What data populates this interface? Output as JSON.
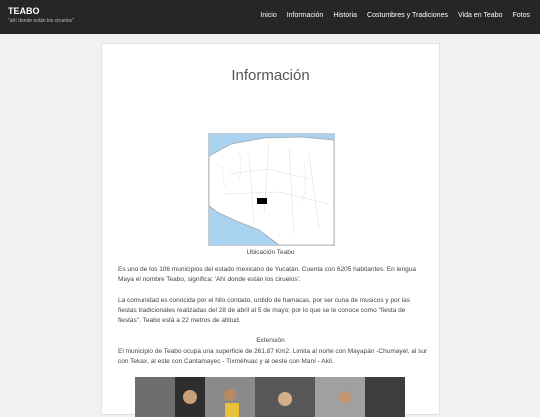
{
  "site": {
    "title": "TEABO",
    "description": "\"ahí donde están los ciruelos\""
  },
  "nav": {
    "items": [
      {
        "label": "Inicio"
      },
      {
        "label": "Información"
      },
      {
        "label": "Historia"
      },
      {
        "label": "Costumbres y Tradiciones"
      },
      {
        "label": "Vida en Teabo"
      },
      {
        "label": "Fotos"
      }
    ]
  },
  "page": {
    "title": "Información",
    "map_caption": "Ubicación Teabo",
    "paragraphs": [
      "Es uno de los 106 municipios del estado mexicano de Yucatán. Cuenta con 6205 habitantes. En lengua Maya el nombre Teabo, significa: 'Ahí donde están los ciruelos'.",
      "La comunidad es conocida por el hilo contado, urdido de hamacas, por ser cuna de musicos y por las fiestas tradicionales realizadas del 28 de abril al 5 de mayo; por lo que se le conoce como \"fiesta de fiestas\". Teabo está a 22 metros de altitud."
    ],
    "extension_heading": "Extensión",
    "extension_text": "El municipio de Teabo ocupa una superficie de 261.87 Km2. Limita al norte con Mayapán -Chumayel, al sur con Tekax, al este con Cantamayec - Tixméhuac y al oeste con Maní - Akil."
  },
  "colors": {
    "topbar": "#262626",
    "page_bg": "#f1f1f1",
    "card_bg": "#ffffff"
  }
}
